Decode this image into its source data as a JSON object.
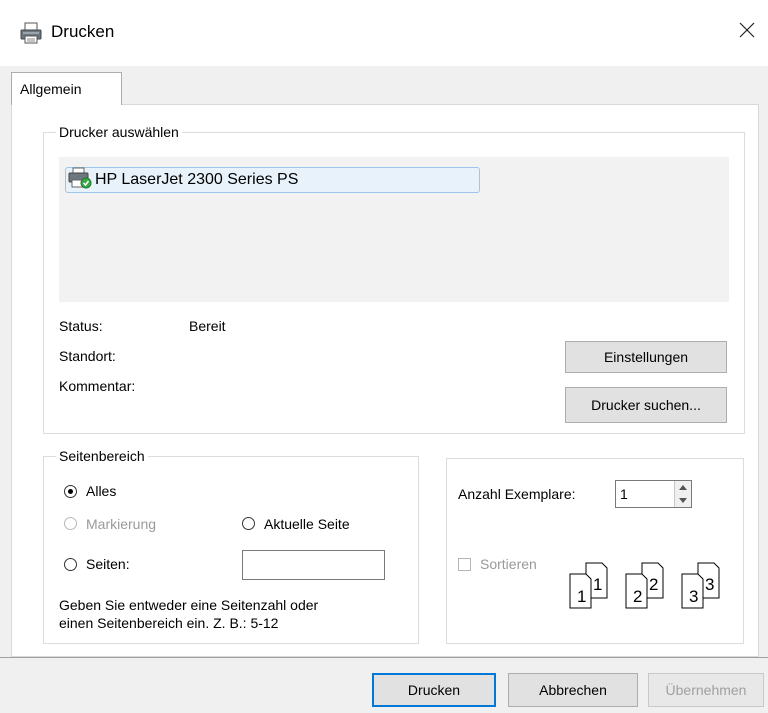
{
  "window": {
    "title": "Drucken",
    "icon": "printer-icon",
    "close_icon": "close-icon"
  },
  "tabs": [
    {
      "label": "Allgemein",
      "selected": true
    }
  ],
  "printer_group": {
    "legend": "Drucker auswählen",
    "printers": [
      {
        "name": "HP LaserJet 2300 Series PS",
        "selected": true,
        "icon": "printer-default-icon"
      }
    ],
    "status_label": "Status:",
    "status_value": "Bereit",
    "location_label": "Standort:",
    "location_value": "",
    "comment_label": "Kommentar:",
    "comment_value": "",
    "settings_button": "Einstellungen",
    "find_printer_button": "Drucker suchen..."
  },
  "range_group": {
    "legend": "Seitenbereich",
    "options": {
      "all": {
        "label": "Alles",
        "checked": true,
        "enabled": true
      },
      "selection": {
        "label": "Markierung",
        "checked": false,
        "enabled": false
      },
      "current": {
        "label": "Aktuelle Seite",
        "checked": false,
        "enabled": true
      },
      "pages": {
        "label": "Seiten:",
        "checked": false,
        "enabled": true
      }
    },
    "pages_value": "",
    "hint_line1": "Geben Sie entweder eine Seitenzahl oder",
    "hint_line2": "einen Seitenbereich ein. Z. B.: 5-12"
  },
  "copies_group": {
    "copies_label": "Anzahl Exemplare:",
    "copies_value": "1",
    "collate_label": "Sortieren",
    "collate_checked": false,
    "collate_enabled": false,
    "collate_icon": "collate-pages-icon",
    "collate_sets": [
      {
        "back": "1",
        "front": "1"
      },
      {
        "back": "2",
        "front": "2"
      },
      {
        "back": "3",
        "front": "3"
      }
    ]
  },
  "footer": {
    "print_button": "Drucken",
    "cancel_button": "Abbrechen",
    "apply_button": "Übernehmen"
  }
}
